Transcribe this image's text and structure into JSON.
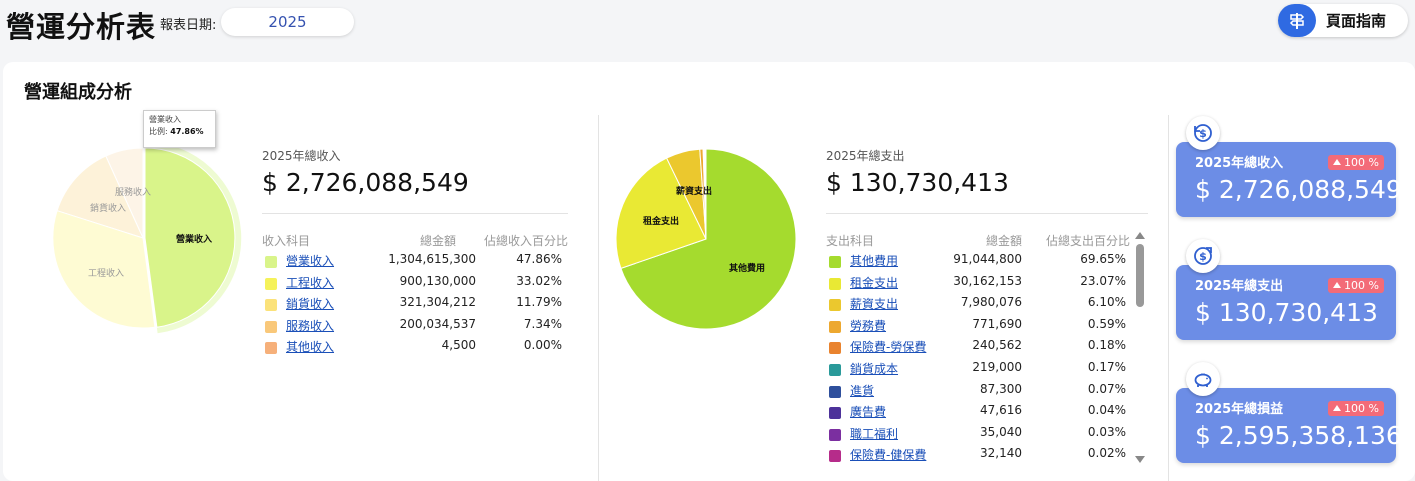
{
  "header": {
    "title": "營運分析表",
    "date_label": "報表日期:",
    "year": "2025",
    "guide_label": "頁面指南"
  },
  "section": {
    "title": "營運組成分析"
  },
  "income": {
    "total_caption": "2025年總收入",
    "total_value": "$ 2,726,088,549",
    "headers": [
      "收入科目",
      "總金額",
      "佔總收入百分比"
    ],
    "rows": [
      {
        "name": "營業收入",
        "amount": "1,304,615,300",
        "pct": "47.86%",
        "color": "#d9f48a"
      },
      {
        "name": "工程收入",
        "amount": "900,130,000",
        "pct": "33.02%",
        "color": "#f5f25a"
      },
      {
        "name": "銷貨收入",
        "amount": "321,304,212",
        "pct": "11.79%",
        "color": "#fbe27a"
      },
      {
        "name": "服務收入",
        "amount": "200,034,537",
        "pct": "7.34%",
        "color": "#f9c87a"
      },
      {
        "name": "其他收入",
        "amount": "4,500",
        "pct": "0.00%",
        "color": "#f6b07a"
      }
    ],
    "tooltip": {
      "name": "營業收入",
      "ratio_label": "比例:",
      "ratio_value": "47.86%"
    },
    "pie_labels": [
      "營業收入",
      "工程收入",
      "銷貨收入",
      "服務收入"
    ]
  },
  "expense": {
    "total_caption": "2025年總支出",
    "total_value": "$ 130,730,413",
    "headers": [
      "支出科目",
      "總金額",
      "佔總支出百分比"
    ],
    "rows": [
      {
        "name": "其他費用",
        "amount": "91,044,800",
        "pct": "69.65%",
        "color": "#a5db2e"
      },
      {
        "name": "租金支出",
        "amount": "30,162,153",
        "pct": "23.07%",
        "color": "#e9e934"
      },
      {
        "name": "薪資支出",
        "amount": "7,980,076",
        "pct": "6.10%",
        "color": "#ebc82e"
      },
      {
        "name": "勞務費",
        "amount": "771,690",
        "pct": "0.59%",
        "color": "#eda830"
      },
      {
        "name": "保險費-勞保費",
        "amount": "240,562",
        "pct": "0.18%",
        "color": "#e9832e"
      },
      {
        "name": "銷貨成本",
        "amount": "219,000",
        "pct": "0.17%",
        "color": "#2a9a9a"
      },
      {
        "name": "進貨",
        "amount": "87,300",
        "pct": "0.07%",
        "color": "#2e4f9c"
      },
      {
        "name": "廣告費",
        "amount": "47,616",
        "pct": "0.04%",
        "color": "#4d329a"
      },
      {
        "name": "職工福利",
        "amount": "35,040",
        "pct": "0.03%",
        "color": "#7b2fa0"
      },
      {
        "name": "保險費-健保費",
        "amount": "32,140",
        "pct": "0.02%",
        "color": "#b62c8a"
      }
    ],
    "pie_labels": [
      "其他費用",
      "租金支出",
      "薪資支出"
    ]
  },
  "kpis": [
    {
      "label": "2025年總收入",
      "value": "$ 2,726,088,549",
      "badge": "100 %",
      "icon": "dollar-refresh-icon"
    },
    {
      "label": "2025年總支出",
      "value": "$ 130,730,413",
      "badge": "100 %",
      "icon": "dollar-out-icon"
    },
    {
      "label": "2025年總損益",
      "value": "$ 2,595,358,136",
      "badge": "100 %",
      "icon": "piggy-bank-icon"
    }
  ]
}
